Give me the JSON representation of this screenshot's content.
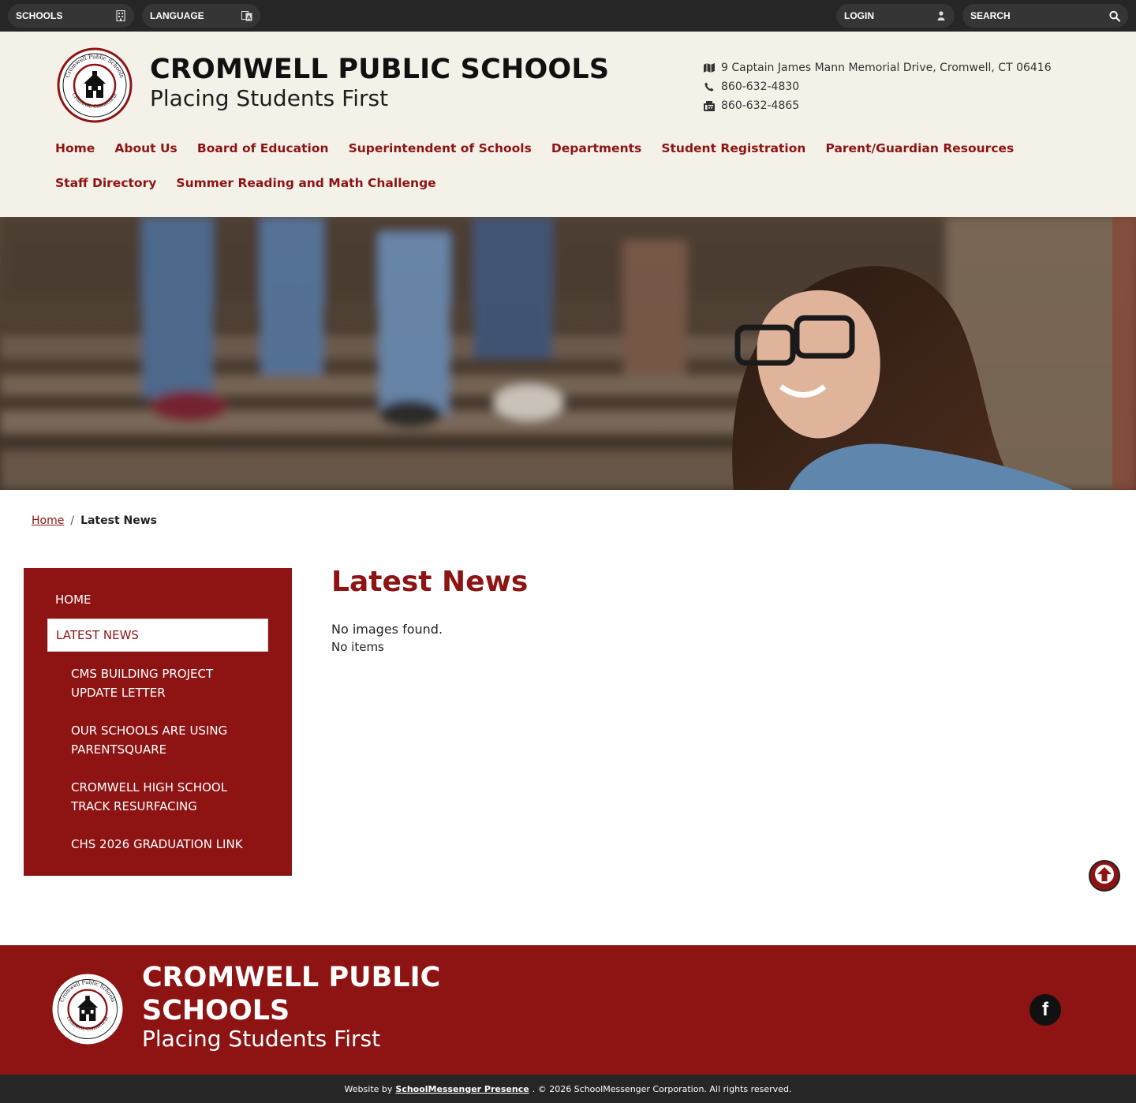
{
  "topbar": {
    "schools_label": "SCHOOLS",
    "language_label": "LANGUAGE",
    "login_label": "LOGIN",
    "search_label": "SEARCH"
  },
  "header": {
    "title": "CROMWELL PUBLIC SCHOOLS",
    "tagline": "Placing Students First",
    "address": "9 Captain James Mann Memorial Drive, Cromwell, CT 06416",
    "phone": "860-632-4830",
    "fax": "860-632-4865",
    "logo_text_top": "Cromwell Public Schools",
    "logo_text_bottom": "Cromwell, Connecticut"
  },
  "nav": {
    "items": [
      "Home",
      "About Us",
      "Board of Education",
      "Superintendent of Schools",
      "Departments",
      "Student Registration",
      "Parent/Guardian Resources",
      "Staff Directory",
      "Summer Reading and Math Challenge"
    ]
  },
  "breadcrumb": {
    "home": "Home",
    "separator": "/",
    "current": "Latest News"
  },
  "sidebar": {
    "home": "HOME",
    "active": "LATEST NEWS",
    "sub": [
      "CMS BUILDING PROJECT UPDATE LETTER",
      "OUR SCHOOLS ARE USING PARENTSQUARE",
      "CROMWELL HIGH SCHOOL TRACK RESURFACING",
      "CHS 2026 GRADUATION LINK"
    ]
  },
  "main": {
    "title": "Latest News",
    "no_images": "No images found.",
    "no_items": "No items"
  },
  "footer": {
    "title": "CROMWELL PUBLIC SCHOOLS",
    "tagline": "Placing Students First",
    "social_icon": "facebook-icon"
  },
  "bottom": {
    "prefix": "Website by",
    "link": "SchoolMessenger Presence",
    "suffix": ". © 2026 SchoolMessenger Corporation. All rights reserved."
  },
  "colors": {
    "brand": "#8e1414",
    "header_bg": "#f4f2e8",
    "topbar_bg": "#262626"
  }
}
